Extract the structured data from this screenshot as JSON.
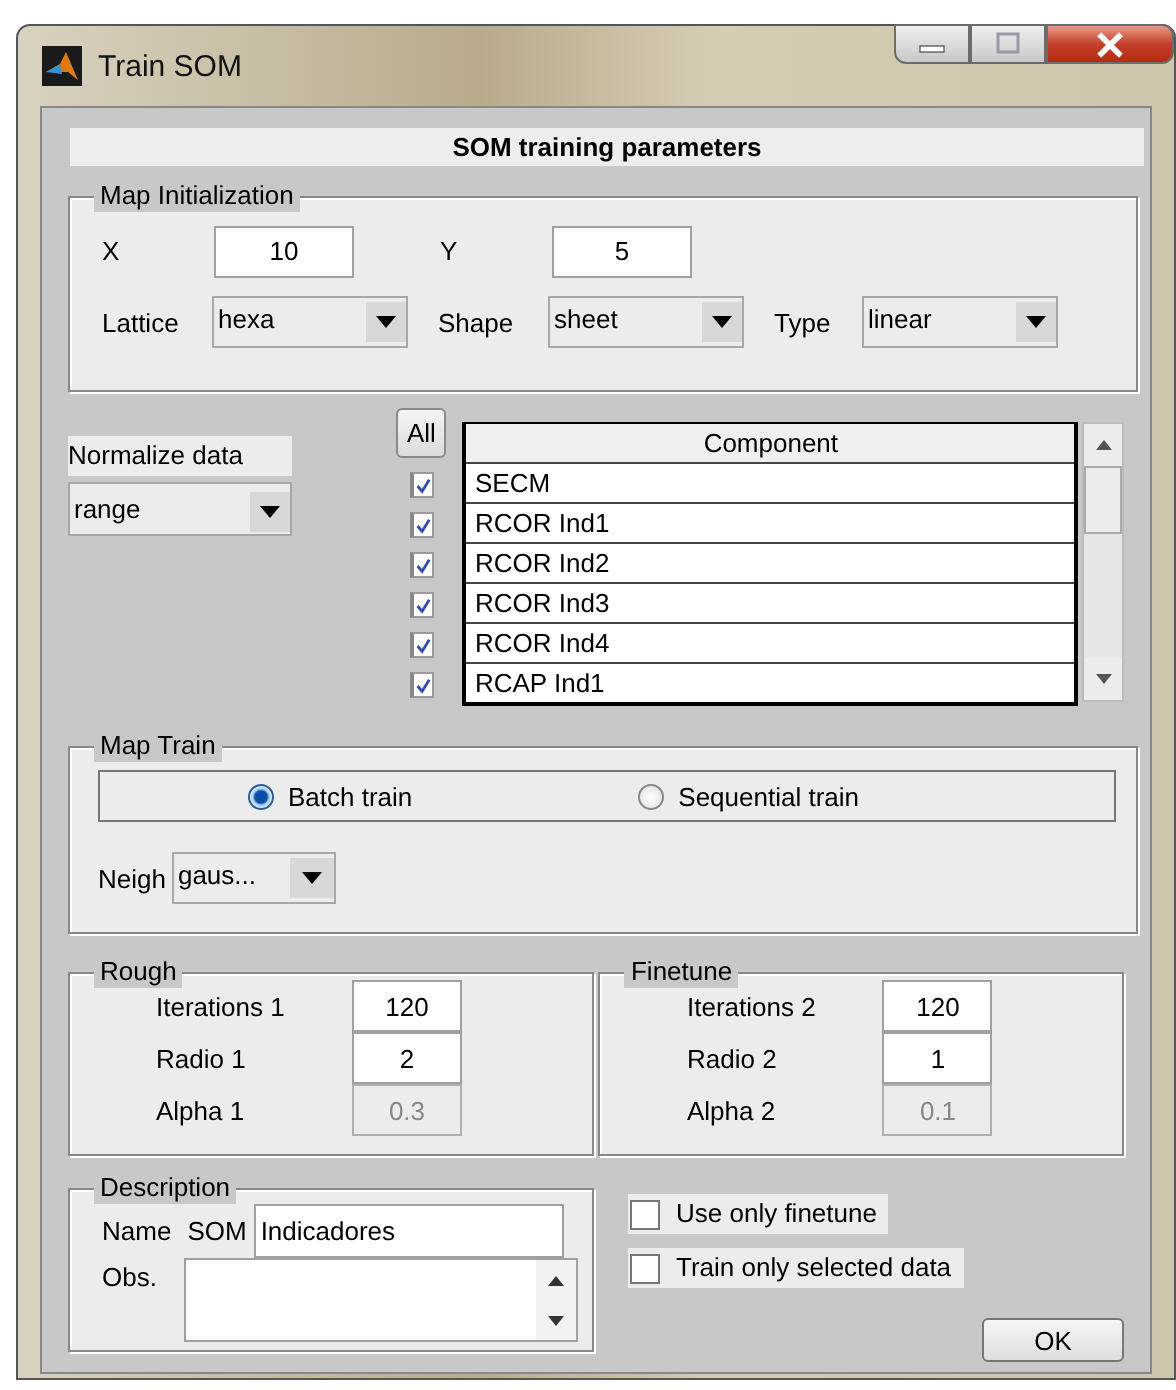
{
  "window": {
    "title": "Train SOM"
  },
  "header": "SOM training parameters",
  "map_initialization": {
    "title": "Map Initialization",
    "size_fields": [
      {
        "label": "X",
        "value": "10"
      },
      {
        "label": "Y",
        "value": "5"
      }
    ],
    "dropdowns": [
      {
        "label": "Lattice",
        "value": "hexa"
      },
      {
        "label": "Shape",
        "value": "sheet"
      },
      {
        "label": "Type",
        "value": "linear"
      }
    ]
  },
  "normalize": {
    "label": "Normalize data",
    "value": "range"
  },
  "components": {
    "all_button": "All",
    "column": "Component",
    "rows": [
      {
        "name": "SECM",
        "checked": true
      },
      {
        "name": "RCOR Ind1",
        "checked": true
      },
      {
        "name": "RCOR Ind2",
        "checked": true
      },
      {
        "name": "RCOR Ind3",
        "checked": true
      },
      {
        "name": "RCOR Ind4",
        "checked": true
      },
      {
        "name": "RCAP Ind1",
        "checked": true
      }
    ]
  },
  "map_train": {
    "title": "Map Train",
    "options": [
      {
        "label": "Batch train",
        "selected": true
      },
      {
        "label": "Sequential train",
        "selected": false
      }
    ],
    "neigh": {
      "label": "Neigh",
      "value": "gaus..."
    }
  },
  "phases": [
    {
      "title": "Rough",
      "fields": [
        {
          "label": "Iterations 1",
          "value": "120",
          "disabled": false
        },
        {
          "label": "Radio 1",
          "value": "2",
          "disabled": false
        },
        {
          "label": "Alpha 1",
          "value": "0.3",
          "disabled": true
        }
      ]
    },
    {
      "title": "Finetune",
      "fields": [
        {
          "label": "Iterations 2",
          "value": "120",
          "disabled": false
        },
        {
          "label": "Radio 2",
          "value": "1",
          "disabled": false
        },
        {
          "label": "Alpha 2",
          "value": "0.1",
          "disabled": true
        }
      ]
    }
  ],
  "description": {
    "title": "Description",
    "name_label": "Name",
    "name_prefix": "SOM",
    "name_value": "Indicadores",
    "obs_label": "Obs."
  },
  "options": [
    {
      "label": "Use only finetune",
      "checked": false
    },
    {
      "label": "Train only selected data",
      "checked": false
    }
  ],
  "ok_button": "OK"
}
